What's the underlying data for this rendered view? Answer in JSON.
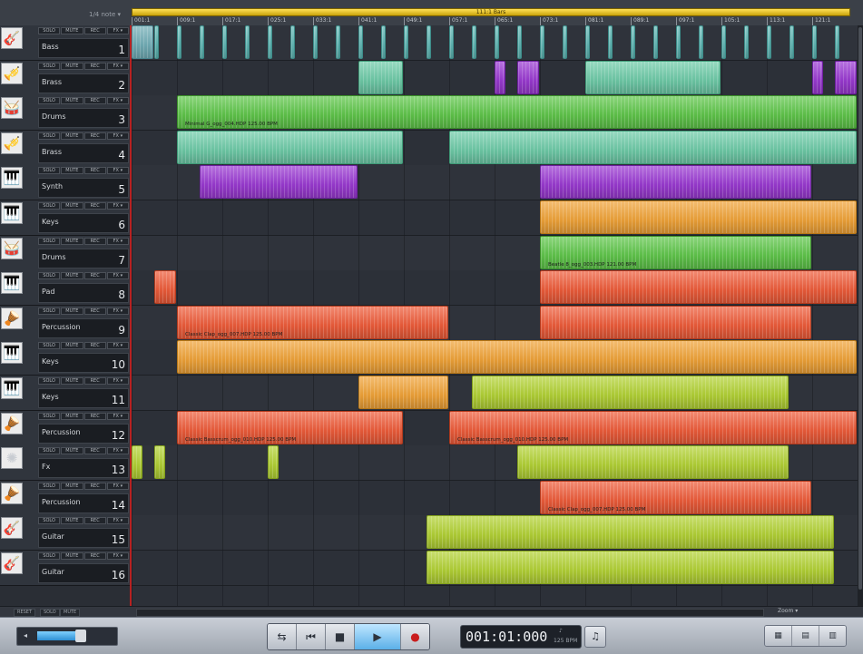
{
  "snap": "1/4 note",
  "ruler": {
    "loop_label": "111:1 Bars",
    "ticks": [
      "001:1",
      "009:1",
      "017:1",
      "025:1",
      "033:1",
      "041:1",
      "049:1",
      "057:1",
      "065:1",
      "073:1",
      "081:1",
      "089:1",
      "097:1",
      "105:1",
      "113:1",
      "121:1"
    ]
  },
  "track_buttons": {
    "solo": "SOLO",
    "mute": "MUTE",
    "rec": "REC",
    "fx": "FX ▾"
  },
  "tracks": [
    {
      "num": "1",
      "name": "Bass",
      "icon": "bass-guitar-icon",
      "glyph": "🎸"
    },
    {
      "num": "2",
      "name": "Brass",
      "icon": "trumpet-icon",
      "glyph": "🎺"
    },
    {
      "num": "3",
      "name": "Drums",
      "icon": "drum-icon",
      "glyph": "🥁"
    },
    {
      "num": "4",
      "name": "Brass",
      "icon": "trumpet-icon",
      "glyph": "🎺"
    },
    {
      "num": "5",
      "name": "Synth",
      "icon": "synth-icon",
      "glyph": "🎹"
    },
    {
      "num": "6",
      "name": "Keys",
      "icon": "keyboard-icon",
      "glyph": "🎹"
    },
    {
      "num": "7",
      "name": "Drums",
      "icon": "drum-icon",
      "glyph": "🥁"
    },
    {
      "num": "8",
      "name": "Pad",
      "icon": "synth-icon",
      "glyph": "🎹"
    },
    {
      "num": "9",
      "name": "Percussion",
      "icon": "congas-icon",
      "glyph": "🪘"
    },
    {
      "num": "10",
      "name": "Keys",
      "icon": "keyboard-icon",
      "glyph": "🎹"
    },
    {
      "num": "11",
      "name": "Keys",
      "icon": "keyboard-icon",
      "glyph": "🎹"
    },
    {
      "num": "12",
      "name": "Percussion",
      "icon": "congas-icon",
      "glyph": "🪘"
    },
    {
      "num": "13",
      "name": "Fx",
      "icon": "sound-fx-icon",
      "glyph": "✺"
    },
    {
      "num": "14",
      "name": "Percussion",
      "icon": "congas-icon",
      "glyph": "🪘"
    },
    {
      "num": "15",
      "name": "Guitar",
      "icon": "guitar-icon",
      "glyph": "🎸"
    },
    {
      "num": "16",
      "name": "Guitar",
      "icon": "guitar-icon",
      "glyph": "🎸"
    }
  ],
  "objects": [
    {
      "lane": 0,
      "color": "c-bluegrey",
      "start": 1,
      "len": 4,
      "title": ""
    },
    {
      "lane": 0,
      "color": "c-teal",
      "start": 5,
      "len": 1,
      "title": ""
    },
    {
      "lane": 0,
      "color": "c-teal",
      "start": 9,
      "len": 1,
      "title": ""
    },
    {
      "lane": 0,
      "color": "c-teal",
      "start": 13,
      "len": 1,
      "title": ""
    },
    {
      "lane": 0,
      "color": "c-teal",
      "start": 17,
      "len": 1,
      "title": ""
    },
    {
      "lane": 0,
      "color": "c-teal",
      "start": 21,
      "len": 1,
      "title": ""
    },
    {
      "lane": 0,
      "color": "c-teal",
      "start": 25,
      "len": 1,
      "title": ""
    },
    {
      "lane": 0,
      "color": "c-teal",
      "start": 29,
      "len": 1,
      "title": ""
    },
    {
      "lane": 0,
      "color": "c-teal",
      "start": 33,
      "len": 1,
      "title": ""
    },
    {
      "lane": 0,
      "color": "c-teal",
      "start": 37,
      "len": 1,
      "title": ""
    },
    {
      "lane": 0,
      "color": "c-teal",
      "start": 41,
      "len": 1,
      "title": ""
    },
    {
      "lane": 0,
      "color": "c-teal",
      "start": 45,
      "len": 1,
      "title": ""
    },
    {
      "lane": 0,
      "color": "c-teal",
      "start": 49,
      "len": 1,
      "title": ""
    },
    {
      "lane": 0,
      "color": "c-teal",
      "start": 53,
      "len": 1,
      "title": ""
    },
    {
      "lane": 0,
      "color": "c-teal",
      "start": 57,
      "len": 1,
      "title": ""
    },
    {
      "lane": 0,
      "color": "c-teal",
      "start": 61,
      "len": 1,
      "title": ""
    },
    {
      "lane": 0,
      "color": "c-teal",
      "start": 65,
      "len": 1,
      "title": ""
    },
    {
      "lane": 0,
      "color": "c-teal",
      "start": 69,
      "len": 1,
      "title": ""
    },
    {
      "lane": 0,
      "color": "c-teal",
      "start": 73,
      "len": 1,
      "title": ""
    },
    {
      "lane": 0,
      "color": "c-teal",
      "start": 77,
      "len": 1,
      "title": ""
    },
    {
      "lane": 0,
      "color": "c-teal",
      "start": 81,
      "len": 1,
      "title": ""
    },
    {
      "lane": 0,
      "color": "c-teal",
      "start": 85,
      "len": 1,
      "title": ""
    },
    {
      "lane": 0,
      "color": "c-teal",
      "start": 89,
      "len": 1,
      "title": ""
    },
    {
      "lane": 0,
      "color": "c-teal",
      "start": 93,
      "len": 1,
      "title": ""
    },
    {
      "lane": 0,
      "color": "c-teal",
      "start": 97,
      "len": 1,
      "title": ""
    },
    {
      "lane": 0,
      "color": "c-teal",
      "start": 101,
      "len": 1,
      "title": ""
    },
    {
      "lane": 0,
      "color": "c-teal",
      "start": 105,
      "len": 1,
      "title": ""
    },
    {
      "lane": 0,
      "color": "c-teal",
      "start": 109,
      "len": 1,
      "title": ""
    },
    {
      "lane": 0,
      "color": "c-teal",
      "start": 113,
      "len": 1,
      "title": ""
    },
    {
      "lane": 0,
      "color": "c-teal",
      "start": 117,
      "len": 1,
      "title": ""
    },
    {
      "lane": 0,
      "color": "c-teal",
      "start": 121,
      "len": 1,
      "title": ""
    },
    {
      "lane": 0,
      "color": "c-teal",
      "start": 125,
      "len": 1,
      "title": ""
    },
    {
      "lane": 1,
      "color": "c-mint",
      "start": 41,
      "len": 8,
      "title": ""
    },
    {
      "lane": 1,
      "color": "c-purple",
      "start": 65,
      "len": 2,
      "title": ""
    },
    {
      "lane": 1,
      "color": "c-purple",
      "start": 69,
      "len": 4,
      "title": ""
    },
    {
      "lane": 1,
      "color": "c-mint",
      "start": 81,
      "len": 24,
      "title": ""
    },
    {
      "lane": 1,
      "color": "c-purple",
      "start": 121,
      "len": 2,
      "title": ""
    },
    {
      "lane": 1,
      "color": "c-purple",
      "start": 125,
      "len": 4,
      "title": ""
    },
    {
      "lane": 2,
      "color": "c-green",
      "start": 9,
      "len": 120,
      "title": "Minimal G_ogg_004.HDP  125.00 BPM"
    },
    {
      "lane": 3,
      "color": "c-mint",
      "start": 9,
      "len": 40,
      "title": ""
    },
    {
      "lane": 3,
      "color": "c-mint",
      "start": 57,
      "len": 72,
      "title": ""
    },
    {
      "lane": 4,
      "color": "c-purple",
      "start": 13,
      "len": 28,
      "title": ""
    },
    {
      "lane": 4,
      "color": "c-purple",
      "start": 73,
      "len": 48,
      "title": ""
    },
    {
      "lane": 5,
      "color": "c-orange",
      "start": 73,
      "len": 56,
      "title": ""
    },
    {
      "lane": 6,
      "color": "c-green",
      "start": 73,
      "len": 48,
      "title": "Beatle 8_ogg_003.HDP  121.00 BPM"
    },
    {
      "lane": 7,
      "color": "c-red",
      "start": 5,
      "len": 4,
      "title": ""
    },
    {
      "lane": 7,
      "color": "c-red",
      "start": 73,
      "len": 56,
      "title": ""
    },
    {
      "lane": 8,
      "color": "c-red",
      "start": 9,
      "len": 48,
      "title": "Classic Clap_ogg_007.HDP  125.00 BPM"
    },
    {
      "lane": 8,
      "color": "c-red",
      "start": 73,
      "len": 48,
      "title": ""
    },
    {
      "lane": 9,
      "color": "c-orange",
      "start": 9,
      "len": 120,
      "title": ""
    },
    {
      "lane": 10,
      "color": "c-orange",
      "start": 41,
      "len": 16,
      "title": ""
    },
    {
      "lane": 10,
      "color": "c-lime",
      "start": 61,
      "len": 56,
      "title": ""
    },
    {
      "lane": 11,
      "color": "c-red",
      "start": 9,
      "len": 40,
      "title": "Classic Basscrum_ogg_010.HDP  125.00 BPM"
    },
    {
      "lane": 11,
      "color": "c-red",
      "start": 57,
      "len": 72,
      "title": "Classic Basscrum_ogg_010.HDP  125.00 BPM"
    },
    {
      "lane": 12,
      "color": "c-lime",
      "start": 1,
      "len": 2,
      "title": ""
    },
    {
      "lane": 12,
      "color": "c-lime",
      "start": 5,
      "len": 2,
      "title": ""
    },
    {
      "lane": 12,
      "color": "c-lime",
      "start": 25,
      "len": 2,
      "title": ""
    },
    {
      "lane": 12,
      "color": "c-lime",
      "start": 69,
      "len": 48,
      "title": ""
    },
    {
      "lane": 13,
      "color": "c-red",
      "start": 73,
      "len": 48,
      "title": "Classic Clap_ogg_007.HDP  125.00 BPM"
    },
    {
      "lane": 14,
      "color": "c-lime",
      "start": 53,
      "len": 72,
      "title": ""
    },
    {
      "lane": 15,
      "color": "c-lime",
      "start": 53,
      "len": 72,
      "title": ""
    }
  ],
  "bottom": {
    "reset": "RESET",
    "solo": "SOLO",
    "mute": "MUTE",
    "zoom": "Zoom ▾"
  },
  "transport": {
    "time": "001:01:000",
    "bpm": "125 BPM",
    "tempo_mark": "♪"
  },
  "colors": {
    "record_red": "#c91d1d",
    "loop_yellow": "#ffe257",
    "track_header_border": "#b72222"
  }
}
